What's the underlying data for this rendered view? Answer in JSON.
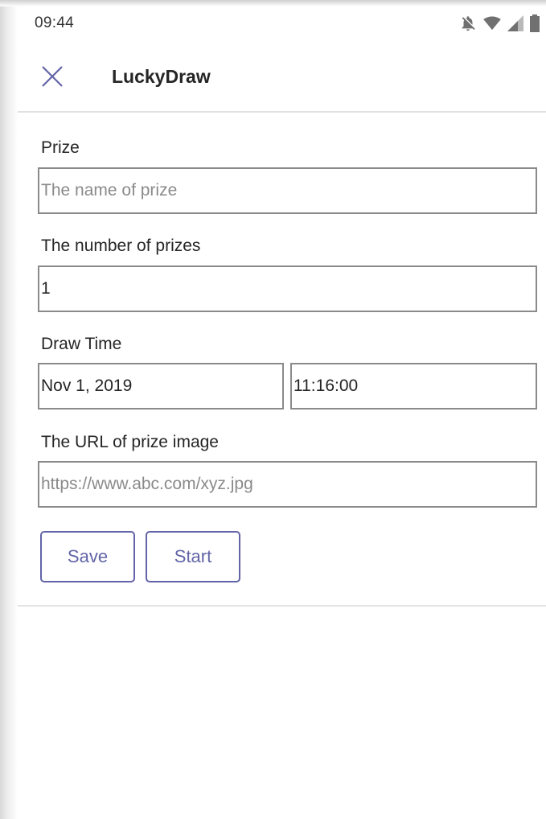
{
  "status_bar": {
    "time": "09:44",
    "icons": [
      "notifications-off-icon",
      "wifi-icon",
      "cell-signal-icon",
      "battery-icon"
    ]
  },
  "header": {
    "title": "LuckyDraw",
    "close_icon": "close-icon"
  },
  "form": {
    "prize": {
      "label": "Prize",
      "value": "",
      "placeholder": "The name of prize"
    },
    "count": {
      "label": "The number of prizes",
      "value": "1"
    },
    "draw_time": {
      "label": "Draw Time",
      "date": "Nov 1, 2019",
      "time": "11:16:00"
    },
    "image_url": {
      "label": "The URL of prize image",
      "value": "",
      "placeholder": "https://www.abc.com/xyz.jpg"
    },
    "save_label": "Save",
    "start_label": "Start"
  },
  "colors": {
    "accent": "#6264a7",
    "text": "#252525",
    "border": "#8a8a8a",
    "placeholder": "#8a8a8a"
  }
}
